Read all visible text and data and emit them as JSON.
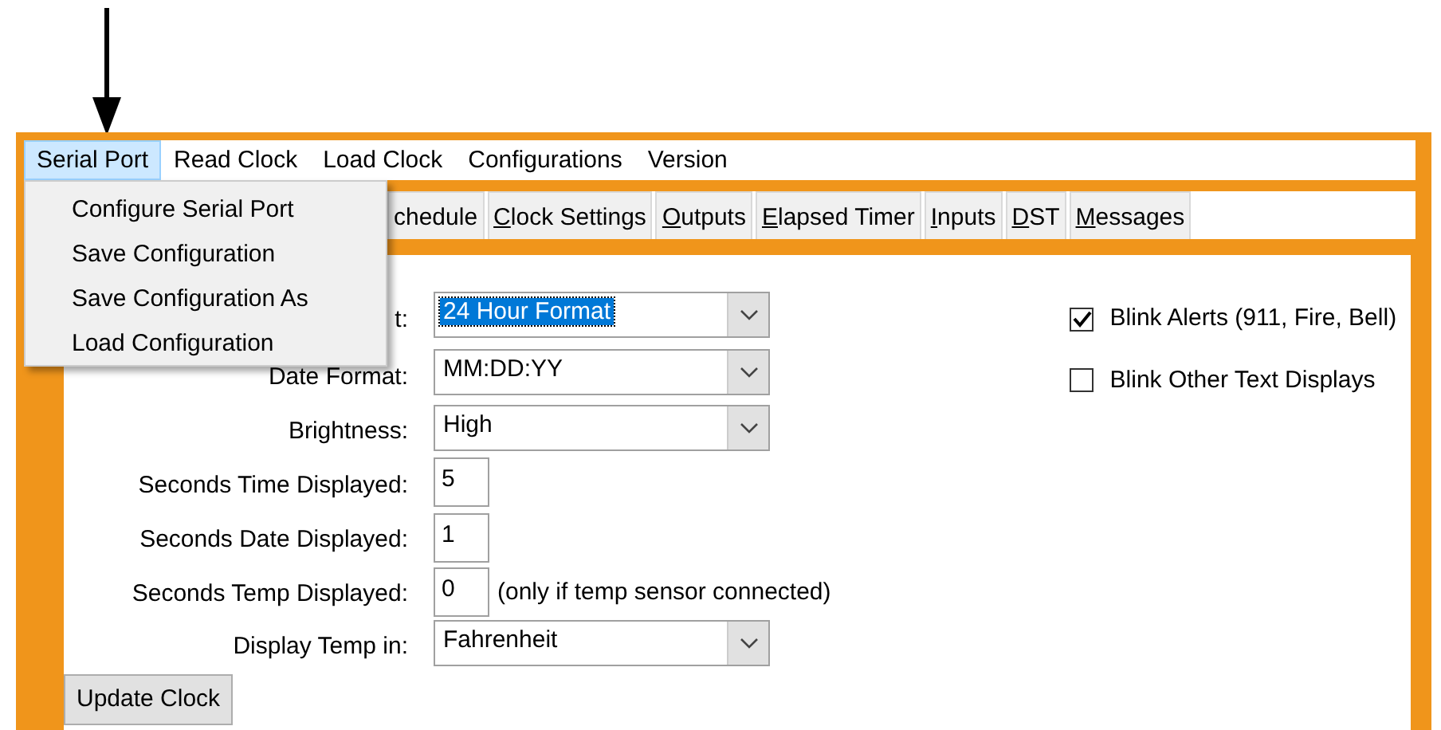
{
  "menu_bar": [
    {
      "label": "Serial Port",
      "selected": true
    },
    {
      "label": "Read Clock",
      "selected": false
    },
    {
      "label": "Load Clock",
      "selected": false
    },
    {
      "label": "Configurations",
      "selected": false
    },
    {
      "label": "Version",
      "selected": false
    }
  ],
  "menu": {
    "items": [
      "Configure Serial Port",
      "Save Configuration",
      "Save Configuration As",
      "Load Configuration"
    ]
  },
  "tabs": [
    {
      "label": "chedule",
      "accel": false
    },
    {
      "label": "Clock Settings",
      "accel": true
    },
    {
      "label": "Outputs",
      "accel": true
    },
    {
      "label": "Elapsed Timer",
      "accel": true
    },
    {
      "label": "Inputs",
      "accel": true
    },
    {
      "label": "DST",
      "accel": true
    },
    {
      "label": "Messages",
      "accel": true
    }
  ],
  "form": {
    "rows": [
      {
        "kind": "select",
        "label": "t:",
        "value": "24 Hour Format",
        "highlighted": true
      },
      {
        "kind": "select",
        "label": "Date Format:",
        "value": "MM:DD:YY",
        "highlighted": false
      },
      {
        "kind": "select",
        "label": "Brightness:",
        "value": "High",
        "highlighted": false
      },
      {
        "kind": "text",
        "label": "Seconds Time Displayed:",
        "value": "5"
      },
      {
        "kind": "text",
        "label": "Seconds Date Displayed:",
        "value": "1"
      },
      {
        "kind": "text",
        "label": "Seconds Temp Displayed:",
        "value": "0",
        "note": "(only if temp sensor connected)"
      },
      {
        "kind": "select",
        "label": "Display Temp in:",
        "value": "Fahrenheit",
        "highlighted": false
      }
    ]
  },
  "checkboxes": [
    {
      "label": "Blink Alerts (911, Fire, Bell)",
      "checked": true
    },
    {
      "label": "Blink Other Text Displays",
      "checked": false
    }
  ],
  "buttons": [
    "Update Clock"
  ]
}
